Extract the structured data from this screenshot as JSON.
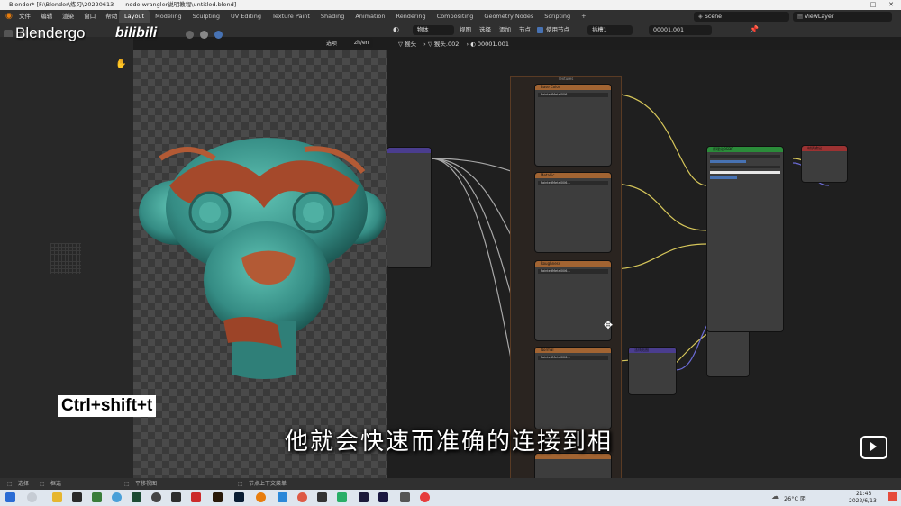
{
  "window": {
    "title": "Blender* [F:\\Blender\\练习\\20220613——node wrangler说明教程\\untitled.blend]",
    "minimize": "—",
    "maximize": "□",
    "close": "✕"
  },
  "menu": {
    "items": [
      "文件",
      "编辑",
      "渲染",
      "窗口",
      "帮助"
    ]
  },
  "workspaces": [
    "Layout",
    "Modeling",
    "Sculpting",
    "UV Editing",
    "Texture Paint",
    "Shading",
    "Animation",
    "Rendering",
    "Compositing",
    "Geometry Nodes",
    "Scripting"
  ],
  "workspace_add": "+",
  "scene": {
    "label": "Scene",
    "viewlayer": "ViewLayer"
  },
  "viewport_header": {
    "options": "选项",
    "lang": "zh/en"
  },
  "node_header": {
    "object": "物体",
    "view": "视图",
    "select": "选择",
    "add": "添加",
    "node": "节点",
    "use_nodes": "使用节点",
    "slot": "插槽1",
    "material": "00001.001"
  },
  "breadcrumb": {
    "obj": "猴头",
    "mesh": "猴头.002",
    "mat": "00001.001"
  },
  "watermark": {
    "brand": "Blendergo",
    "bili": "bilibili"
  },
  "hotkey": "Ctrl+shift+t",
  "subtitle": "他就会快速而准确的连接到相",
  "frame_label": "Textures",
  "nodes": {
    "tex_a": "Base Color",
    "tex_b": "Metallic",
    "tex_c": "Roughness",
    "tex_d": "Normal",
    "image_name": "PaintedMetal006...",
    "bsdf": "原理化BSDF",
    "output": "材质输出",
    "normal_map": "法线贴图",
    "bump": "凹凸"
  },
  "statusbar": {
    "select": "选择",
    "box": "框选",
    "pan": "平移视图",
    "ctx": "节点上下文菜单"
  },
  "taskbar": {
    "weather": "26°C 阴",
    "time": "21:43",
    "date": "2022/6/13"
  },
  "colors": {
    "tex_header": "#a26432",
    "bsdf_header": "#2b8c3a",
    "output_header": "#9c3232",
    "vector_header": "#4a3d8e",
    "link_yellow": "#d6c65a",
    "link_gray": "#a8a8a8",
    "link_purple": "#6b6bd6"
  }
}
